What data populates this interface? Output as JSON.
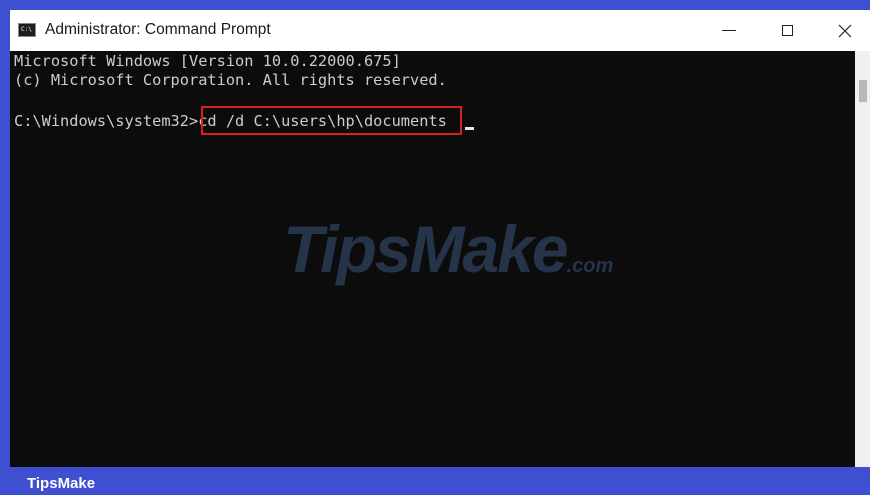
{
  "window": {
    "title": "Administrator: Command Prompt",
    "app_icon_text": "C:\\"
  },
  "console": {
    "lines": [
      "Microsoft Windows [Version 10.0.22000.675]",
      "(c) Microsoft Corporation. All rights reserved."
    ],
    "prompt": "C:\\Windows\\system32>",
    "command": "cd /d C:\\users\\hp\\documents"
  },
  "watermark": {
    "main": "TipsMake",
    "suffix": ".com"
  },
  "footer": {
    "brand": "TipsMake"
  },
  "colors": {
    "frame": "#3f4fd1",
    "console_bg": "#0c0c0c",
    "console_text": "#cccccc",
    "highlight_box": "#d62121"
  },
  "icons": {
    "app": "command-prompt-icon",
    "minimize": "minimize-icon",
    "maximize": "maximize-icon",
    "close": "close-icon"
  }
}
